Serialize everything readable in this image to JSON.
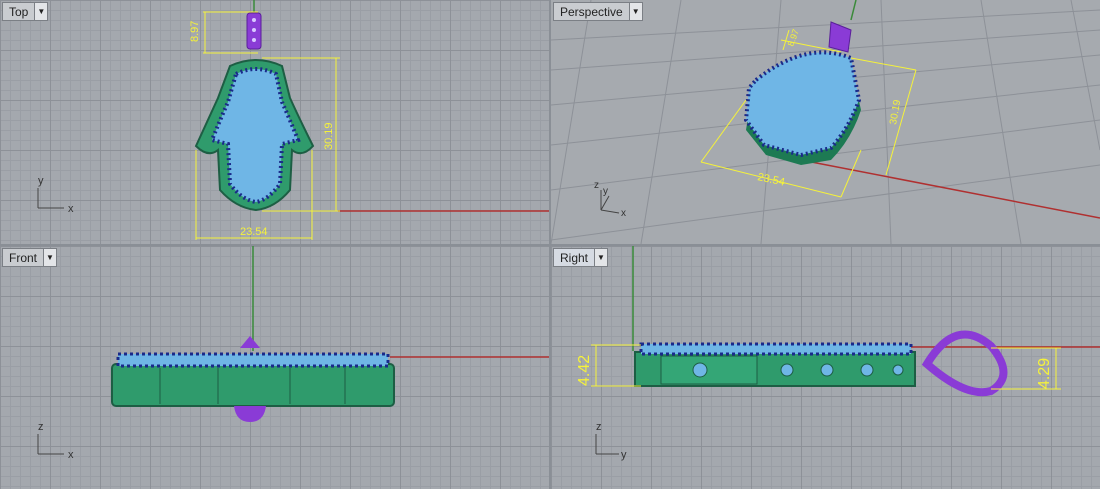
{
  "viewports": {
    "top": {
      "label": "Top",
      "dims": {
        "height": "8.97",
        "length": "30.19",
        "width": "23.54"
      },
      "axis": {
        "v": "y",
        "h": "x"
      }
    },
    "perspective": {
      "label": "Perspective",
      "dims": {
        "small": "8.97",
        "length": "30.19",
        "width": "23.54"
      },
      "axis": {
        "v": "z",
        "v2": "y",
        "h": "x"
      }
    },
    "front": {
      "label": "Front",
      "axis": {
        "v": "z",
        "h": "x"
      }
    },
    "right": {
      "label": "Right",
      "dims": {
        "left": "4.42",
        "right": "4.29"
      },
      "axis": {
        "v": "z",
        "h": "y"
      }
    }
  },
  "colors": {
    "model": "#2f9b6c",
    "gems": "#6fb6e6",
    "prongs": "#1a2a8a",
    "bail": "#8a3bd6",
    "dim": "#f5f23a",
    "axis_x": "#b03030",
    "axis_y": "#3a8a3a"
  },
  "icons": {
    "dropdown": "dropdown-arrow-icon"
  }
}
